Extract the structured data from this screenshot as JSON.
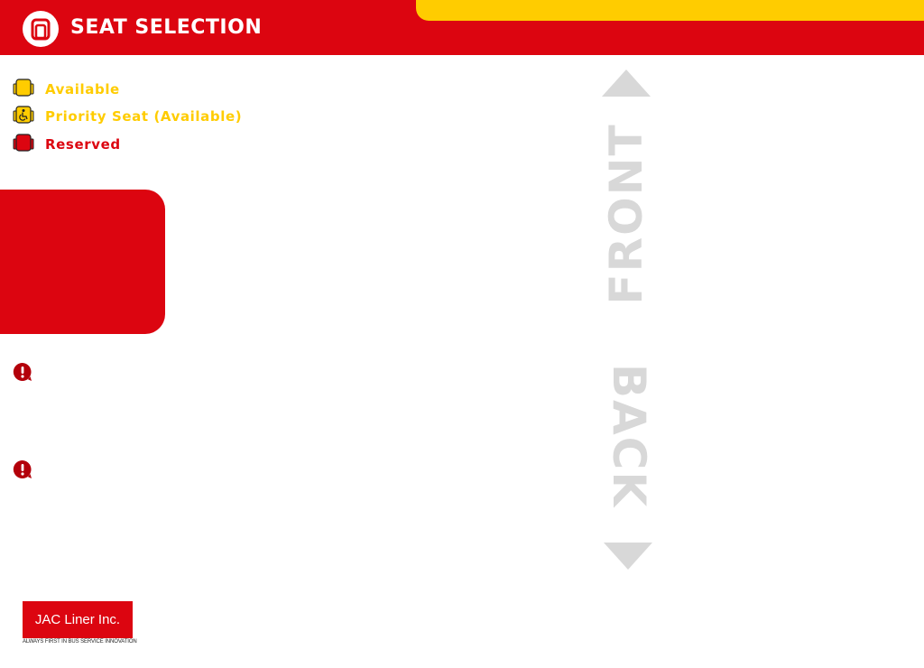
{
  "header": {
    "title": "SEAT SELECTION",
    "logo_icon": "seat-icon"
  },
  "legend": [
    {
      "label": "Available",
      "icon": "seat-available-icon",
      "color": "#ffcc00"
    },
    {
      "label": "Priority Seat (Available)",
      "icon": "seat-priority-icon",
      "color": "#ffcc00"
    },
    {
      "label": "Reserved",
      "icon": "seat-reserved-icon",
      "color": "#dc0510"
    }
  ],
  "notices": [
    {
      "icon": "exclamation-icon"
    },
    {
      "icon": "exclamation-icon"
    }
  ],
  "direction": {
    "front": "FRONT",
    "back": "BACK"
  },
  "brand": {
    "name": "JAC Liner Inc.",
    "tagline": "ALWAYS FIRST IN BUS  SERVICE INNOVATION"
  },
  "colors": {
    "primary_red": "#dc0510",
    "accent_yellow": "#ffcc00",
    "direction_gray": "#d8d8d8"
  }
}
